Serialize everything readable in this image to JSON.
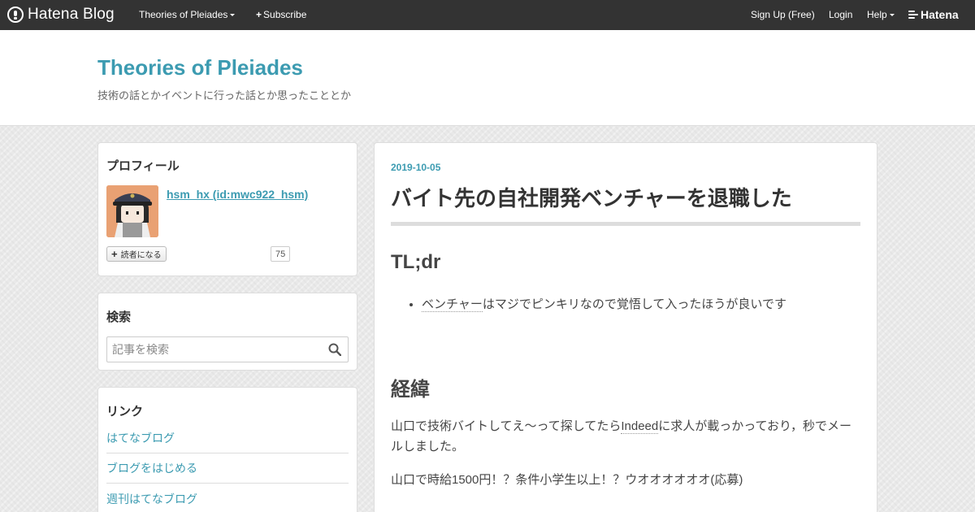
{
  "globalbar": {
    "logo_text": "Hatena Blog",
    "blog_menu": "Theories of Pleiades",
    "subscribe": "Subscribe",
    "signup": "Sign Up (Free)",
    "login": "Login",
    "help": "Help",
    "hatena_logo": "Hatena"
  },
  "header": {
    "blog_title": "Theories of Pleiades",
    "description": "技術の話とかイベントに行った話とか思ったこととか"
  },
  "sidebar": {
    "profile": {
      "title": "プロフィール",
      "name": "hsm_hx (id:mwc922_hsm)",
      "reader_button": "読者になる",
      "reader_count": "75"
    },
    "search": {
      "title": "検索",
      "placeholder": "記事を検索"
    },
    "links": {
      "title": "リンク",
      "items": [
        "はてなブログ",
        "ブログをはじめる",
        "週刊はてなブログ"
      ]
    }
  },
  "entry": {
    "date": "2019-10-05",
    "title": "バイト先の自社開発ベンチャーを退職した",
    "section1_heading": "TL;dr",
    "bullet_keyword": "ベンチャー",
    "bullet_rest": "はマジでピンキリなので覚悟して入ったほうが良いです",
    "section2_heading": "経緯",
    "para1_before": "山口で技術バイトしてえ～って探してたら",
    "para1_keyword": "Indeed",
    "para1_after": "に求人が載っかっており，秒でメールしました。",
    "para2": "山口で時給1500円！？条件小学生以上！？ウオオオオオオ(応募)"
  },
  "colors": {
    "accent": "#3c9bb1",
    "globalbar": "#333333",
    "text": "#454545"
  }
}
